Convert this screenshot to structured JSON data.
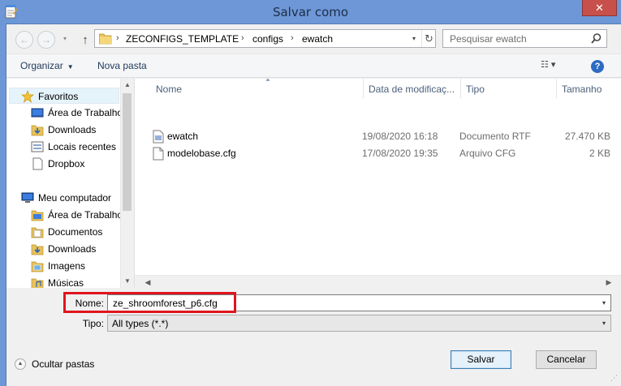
{
  "window": {
    "title": "Salvar como",
    "close_glyph": "✕"
  },
  "nav": {
    "back_glyph": "←",
    "forward_glyph": "→",
    "up_glyph": "↑",
    "history_glyph": "▾"
  },
  "address": {
    "crumbs": [
      "ZECONFIGS_TEMPLATE",
      "configs",
      "ewatch"
    ],
    "separator": "›",
    "dropdown_glyph": "▾",
    "refresh_glyph": "↻"
  },
  "search": {
    "placeholder": "Pesquisar ewatch"
  },
  "toolbar": {
    "organize_label": "Organizar",
    "organize_caret": "▼",
    "new_folder_label": "Nova pasta",
    "view_glyph": "☷ ▾",
    "help_glyph": "?"
  },
  "sidebar": {
    "items": [
      {
        "label": "Favoritos",
        "icon": "star-icon"
      },
      {
        "label": "Área de Trabalho",
        "icon": "desktop-icon"
      },
      {
        "label": "Downloads",
        "icon": "downloads-folder-icon"
      },
      {
        "label": "Locais recentes",
        "icon": "recent-places-icon"
      },
      {
        "label": "Dropbox",
        "icon": "dropbox-icon"
      },
      {
        "label": "Meu computador",
        "icon": "computer-icon"
      },
      {
        "label": "Área de Trabalho",
        "icon": "desktop-folder-icon"
      },
      {
        "label": "Documentos",
        "icon": "documents-folder-icon"
      },
      {
        "label": "Downloads",
        "icon": "downloads-folder-icon"
      },
      {
        "label": "Imagens",
        "icon": "pictures-folder-icon"
      },
      {
        "label": "Músicas",
        "icon": "music-folder-icon"
      }
    ]
  },
  "files": {
    "columns": [
      "Nome",
      "Data de modificaç...",
      "Tipo",
      "Tamanho"
    ],
    "sort_glyph": "▲",
    "rows": [
      {
        "name": "ewatch",
        "date": "19/08/2020 16:18",
        "type": "Documento RTF",
        "size": "27.470 KB",
        "icon": "rtf-document-icon"
      },
      {
        "name": "modelobase.cfg",
        "date": "17/08/2020 19:35",
        "type": "Arquivo CFG",
        "size": "2 KB",
        "icon": "cfg-file-icon"
      }
    ],
    "scroll_left_glyph": "◀",
    "scroll_right_glyph": "▶",
    "scroll_up_glyph": "▲",
    "scroll_down_glyph": "▼"
  },
  "form": {
    "name_label": "Nome:",
    "name_value": "ze_shroomforest_p6.cfg",
    "type_label": "Tipo:",
    "type_value": "All types (*.*)",
    "dropdown_glyph": "▾"
  },
  "footer": {
    "collapse_label": "Ocultar pastas",
    "collapse_glyph": "▲",
    "save_label": "Salvar",
    "cancel_label": "Cancelar",
    "grip_glyph": "⋰"
  },
  "colors": {
    "title_bar": "#6d97d6",
    "close_button": "#c7504b",
    "highlight_box": "#e0141e"
  }
}
